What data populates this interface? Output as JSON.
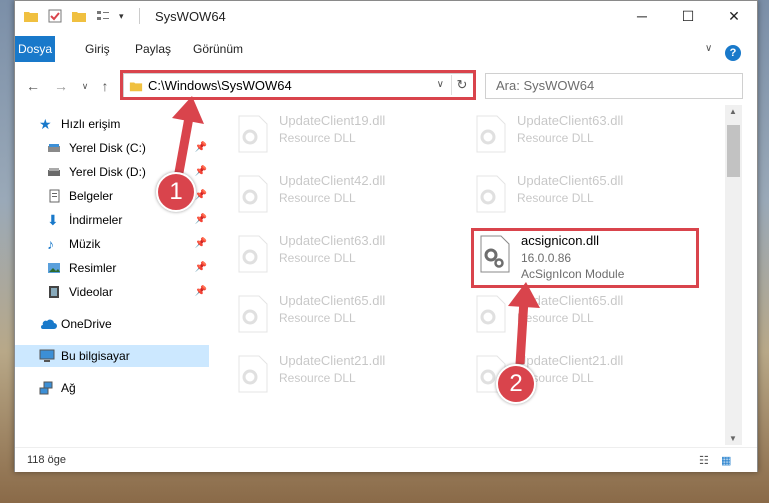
{
  "window": {
    "title": "SysWOW64",
    "minimize": "─",
    "maximize": "☐",
    "close": "✕"
  },
  "ribbon": {
    "tabs": [
      "Dosya",
      "Giriş",
      "Paylaş",
      "Görünüm"
    ],
    "help": "?"
  },
  "address": {
    "path": "C:\\Windows\\SysWOW64",
    "search_placeholder": "Ara: SysWOW64"
  },
  "sidebar": {
    "items": [
      {
        "label": "Hızlı erişim",
        "icon": "star-icon",
        "pinned": false
      },
      {
        "label": "Yerel Disk (C:)",
        "icon": "drive-icon",
        "pinned": true
      },
      {
        "label": "Yerel Disk (D:)",
        "icon": "drive-icon",
        "pinned": true
      },
      {
        "label": "Belgeler",
        "icon": "documents-icon",
        "pinned": true
      },
      {
        "label": "İndirmeler",
        "icon": "downloads-icon",
        "pinned": true
      },
      {
        "label": "Müzik",
        "icon": "music-icon",
        "pinned": true
      },
      {
        "label": "Resimler",
        "icon": "pictures-icon",
        "pinned": true
      },
      {
        "label": "Videolar",
        "icon": "videos-icon",
        "pinned": true
      },
      {
        "label": "OneDrive",
        "icon": "cloud-icon",
        "pinned": false
      },
      {
        "label": "Bu bilgisayar",
        "icon": "computer-icon",
        "pinned": false
      },
      {
        "label": "Ağ",
        "icon": "network-icon",
        "pinned": false
      }
    ]
  },
  "files": [
    {
      "name": "UpdateClient19.dll",
      "type": "Resource DLL"
    },
    {
      "name": "UpdateClient63.dll",
      "type": "Resource DLL"
    },
    {
      "name": "UpdateClient42.dll",
      "type": "Resource DLL"
    },
    {
      "name": "UpdateClient65.dll",
      "type": "Resource DLL"
    },
    {
      "name": "UpdateClient63.dll",
      "type": "Resource DLL"
    },
    {
      "name": "acsignicon.dll",
      "version": "16.0.0.86",
      "type": "AcSignIcon Module"
    },
    {
      "name": "UpdateClient65.dll",
      "type": "Resource DLL"
    },
    {
      "name": "UpdateClient65.dll",
      "type": "Resource DLL"
    },
    {
      "name": "UpdateClient21.dll",
      "type": "Resource DLL"
    },
    {
      "name": "UpdateClient21.dll",
      "type": "Resource DLL"
    }
  ],
  "status": {
    "count": "118 öge"
  },
  "annotations": {
    "step1": "1",
    "step2": "2",
    "color": "#d9444c"
  }
}
